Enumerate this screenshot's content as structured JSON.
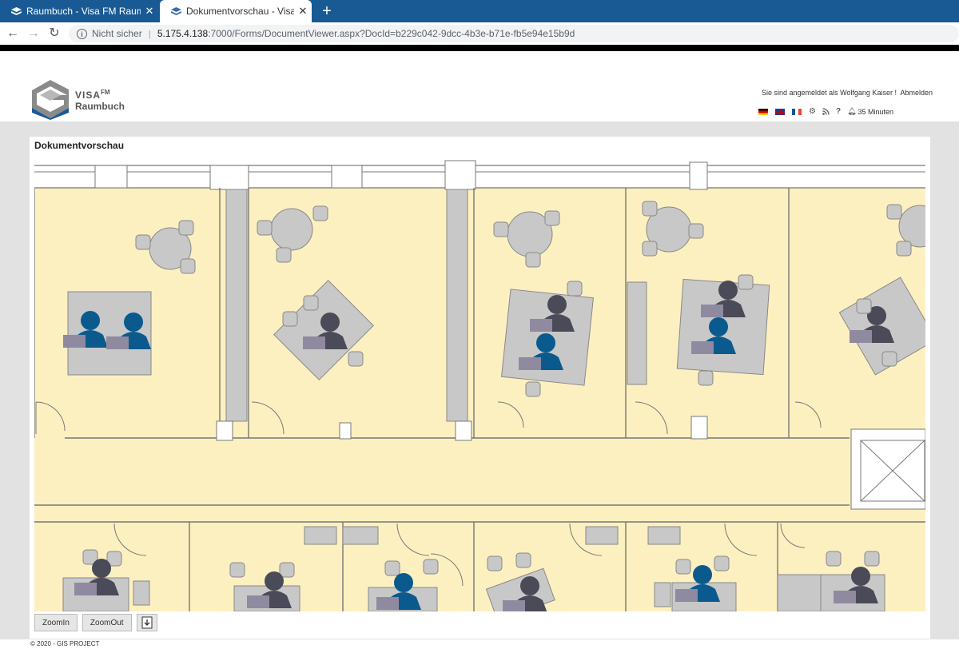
{
  "browser": {
    "tabs": [
      {
        "title": "Raumbuch - Visa FM Raumbuch",
        "close": "✕"
      },
      {
        "title": "Dokumentvorschau - Visa FM Raumbuch",
        "close": "✕"
      }
    ],
    "new_tab": "+",
    "nav": {
      "back": "←",
      "forward": "→",
      "reload": "↻"
    },
    "security": "Nicht sicher",
    "url_host": "5.175.4.138",
    "url_rest": ":7000/Forms/DocumentViewer.aspx?DocId=b229c042-9dcc-4b3e-b71e-fb5e94e15b9d"
  },
  "header": {
    "logo_brand": "VISA",
    "logo_sup": "FM",
    "logo_sub": "Raumbuch",
    "user_text": "Sie sind angemeldet als Wolfgang Kaiser !",
    "logout": "Abmelden",
    "session": "35 Minuten"
  },
  "panel": {
    "title": "Dokumentvorschau"
  },
  "toolbar": {
    "zoom_in": "ZoomIn",
    "zoom_out": "ZoomOut"
  },
  "footer": {
    "copyright": "© 2020 - GIS PROJECT"
  },
  "colors": {
    "floor": "#fdf0c0",
    "furniture": "#c8c8c8",
    "person_blue": "#0a5a8e",
    "person_gray": "#4a4a58",
    "tabbar": "#1a5a94"
  }
}
